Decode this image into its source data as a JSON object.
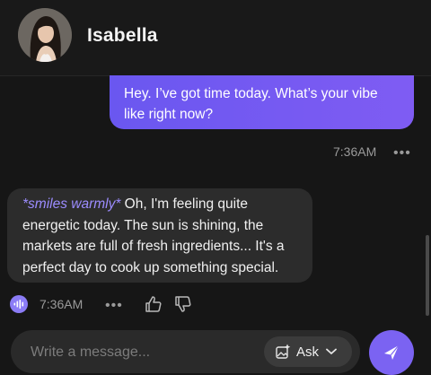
{
  "header": {
    "contact_name": "Isabella",
    "avatar_icon": "avatar-photo"
  },
  "messages": [
    {
      "role": "user",
      "text": "Hey. I’ve got time today. What’s your vibe like right now?",
      "time": "7:36AM",
      "more_label": "•••"
    },
    {
      "role": "assistant",
      "action": "*smiles warmly*",
      "text": " Oh, I'm feeling quite energetic today. The sun is shining, the markets are full of fresh ingredients... It's a perfect day to cook up something special.",
      "time": "7:36AM",
      "more_label": "•••",
      "icons": [
        "voice-play-icon",
        "thumbs-up-icon",
        "thumbs-down-icon"
      ]
    }
  ],
  "composer": {
    "placeholder": "Write a message...",
    "ask_label": "Ask",
    "ask_icon": "sparkle-image-icon",
    "send_icon": "send-arrow-icon"
  },
  "colors": {
    "accent": "#7b63f2",
    "user_bubble_start": "#6a57f0",
    "user_bubble_end": "#7f5cf3",
    "action_text": "#9c8cff",
    "background": "#161616",
    "assistant_bubble": "#2c2c2c"
  }
}
